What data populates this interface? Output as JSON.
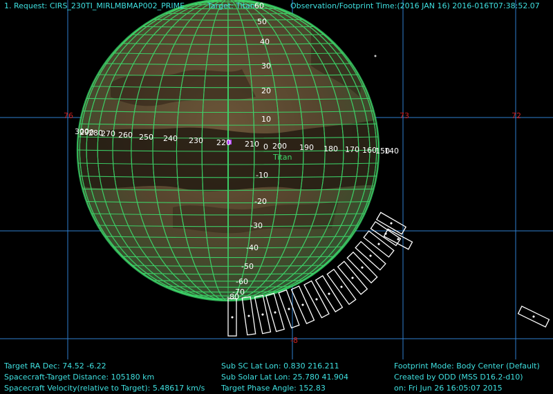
{
  "header": {
    "request": "1. Request: CIRS_230TI_MIRLMBMAP002_PRIME",
    "target": "Target: Titan",
    "obs_time": "Observation/Footprint Time:(2016 JAN 16) 2016-016T07:38:52.07"
  },
  "body_label": "Titan",
  "sky_grid_labels": {
    "ra_76": "76",
    "ra_73": "73",
    "ra_72": "72",
    "dec_minus8": "-8"
  },
  "lat_labels": [
    "60",
    "50",
    "40",
    "30",
    "20",
    "10",
    "0",
    "-10",
    "-20",
    "-30",
    "-40",
    "-50",
    "-60",
    "-70",
    "-80"
  ],
  "lon_labels": [
    "300",
    "290",
    "280",
    "270",
    "260",
    "250",
    "240",
    "230",
    "220",
    "210",
    "200",
    "190",
    "180",
    "170",
    "160",
    "150",
    "140"
  ],
  "info_left": {
    "ra_dec": "Target RA Dec: 74.52   -6.22",
    "distance": "Spacecraft-Target Distance:  105180 km",
    "velocity": "Spacecraft Velocity(relative to Target): 5.48617 km/s"
  },
  "info_mid": {
    "sub_sc": "Sub SC Lat Lon: 0.830  216.211",
    "sub_solar": "Sub Solar Lat Lon: 25.780  41.904",
    "phase": "Target Phase Angle: 152.83"
  },
  "info_right": {
    "mode": "Footprint Mode: Body Center (Default)",
    "created": "Created by ODD (MSS D16.2-d10)",
    "date": "on: Fri Jun 26 16:05:07 2015"
  },
  "colors": {
    "background": "#000000",
    "sky_grid": "#2f7fd0",
    "sky_label": "#d02020",
    "body_grid": "#3ddc6c",
    "header_text": "#3fe0e0",
    "footprint": "#ffffff",
    "sub_sc_marker": "#b040ff"
  }
}
